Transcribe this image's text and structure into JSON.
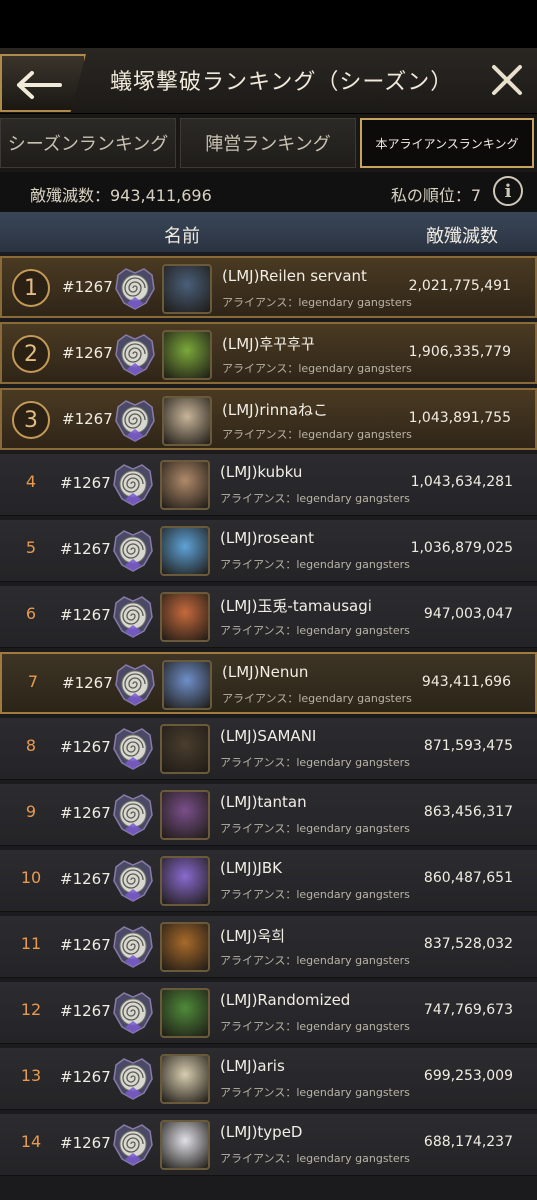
{
  "header": {
    "title": "蟻塚撃破ランキング（シーズン）"
  },
  "tabs": [
    {
      "label": "シーズンランキング",
      "active": false
    },
    {
      "label": "陣営ランキング",
      "active": false
    },
    {
      "label": "本アライアンスランキング",
      "active": true
    }
  ],
  "summary": {
    "kills_label": "敵殲滅数：943,411,696",
    "my_rank_label": "私の順位：7"
  },
  "columns": {
    "name": "名前",
    "score": "敵殲滅数"
  },
  "rows": [
    {
      "rank": "1",
      "server": "#1267",
      "name": "(LMJ)Reilen servant",
      "alliance": "アライアンス：legendary gangsters",
      "score": "2,021,775,491",
      "avatar_color": "#4a5f7a"
    },
    {
      "rank": "2",
      "server": "#1267",
      "name": "(LMJ)후꾸후꾸",
      "alliance": "アライアンス：legendary gangsters",
      "score": "1,906,335,779",
      "avatar_color": "#7ba83a"
    },
    {
      "rank": "3",
      "server": "#1267",
      "name": "(LMJ)rinnaねこ",
      "alliance": "アライアンス：legendary gangsters",
      "score": "1,043,891,755",
      "avatar_color": "#c8b59a"
    },
    {
      "rank": "4",
      "server": "#1267",
      "name": "(LMJ)kubku",
      "alliance": "アライアンス：legendary gangsters",
      "score": "1,043,634,281",
      "avatar_color": "#b08a6a"
    },
    {
      "rank": "5",
      "server": "#1267",
      "name": "(LMJ)roseant",
      "alliance": "アライアンス：legendary gangsters",
      "score": "1,036,879,025",
      "avatar_color": "#5ea3d8"
    },
    {
      "rank": "6",
      "server": "#1267",
      "name": "(LMJ)玉兎-tamausagi",
      "alliance": "アライアンス：legendary gangsters",
      "score": "947,003,047",
      "avatar_color": "#c66a3c"
    },
    {
      "rank": "7",
      "server": "#1267",
      "name": "(LMJ)Nenun",
      "alliance": "アライアンス：legendary gangsters",
      "score": "943,411,696",
      "avatar_color": "#6f8fc9"
    },
    {
      "rank": "8",
      "server": "#1267",
      "name": "(LMJ)SAMANI",
      "alliance": "アライアンス：legendary gangsters",
      "score": "871,593,475",
      "avatar_color": "#4a3e2e"
    },
    {
      "rank": "9",
      "server": "#1267",
      "name": "(LMJ)tantan",
      "alliance": "アライアンス：legendary gangsters",
      "score": "863,456,317",
      "avatar_color": "#7a4f8a"
    },
    {
      "rank": "10",
      "server": "#1267",
      "name": "(LMJ)JBK",
      "alliance": "アライアンス：legendary gangsters",
      "score": "860,487,651",
      "avatar_color": "#8a6ad0"
    },
    {
      "rank": "11",
      "server": "#1267",
      "name": "(LMJ)욱희",
      "alliance": "アライアンス：legendary gangsters",
      "score": "837,528,032",
      "avatar_color": "#a86a2a"
    },
    {
      "rank": "12",
      "server": "#1267",
      "name": "(LMJ)Randomized",
      "alliance": "アライアンス：legendary gangsters",
      "score": "747,769,673",
      "avatar_color": "#4f8a3a"
    },
    {
      "rank": "13",
      "server": "#1267",
      "name": "(LMJ)aris",
      "alliance": "アライアンス：legendary gangsters",
      "score": "699,253,009",
      "avatar_color": "#d8cdb0"
    },
    {
      "rank": "14",
      "server": "#1267",
      "name": "(LMJ)typeD",
      "alliance": "アライアンス：legendary gangsters",
      "score": "688,174,237",
      "avatar_color": "#e0e0e8"
    }
  ],
  "colors": {
    "accent_gold": "#c8a463",
    "rank_orange": "#e89b4f"
  }
}
